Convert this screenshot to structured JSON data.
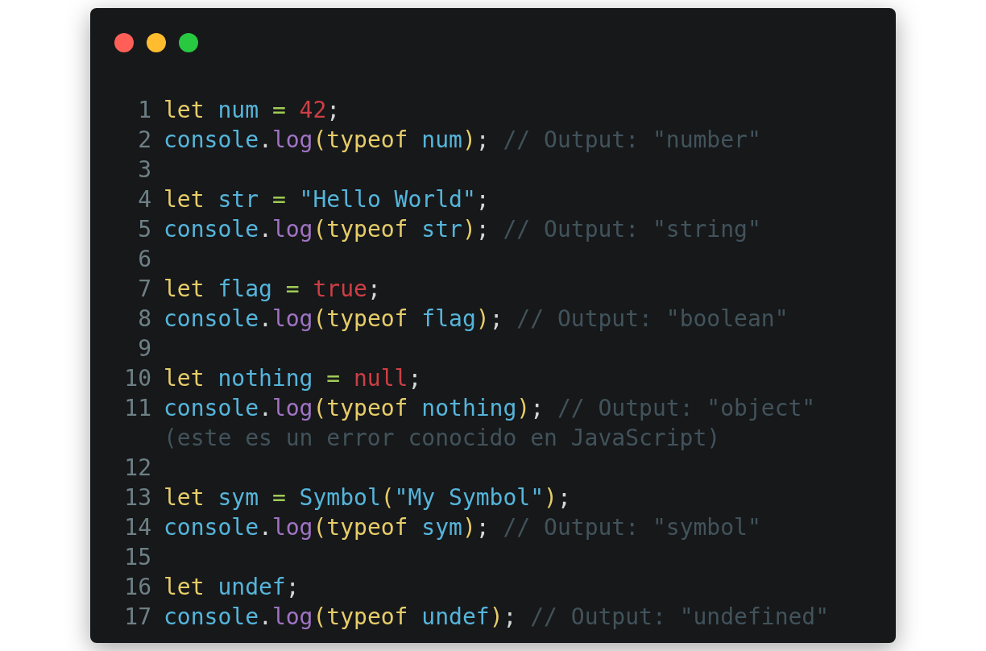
{
  "window": {
    "controls": [
      {
        "color": "#ff5f57"
      },
      {
        "color": "#febc2e"
      },
      {
        "color": "#28c840"
      }
    ]
  },
  "code": {
    "lines": [
      {
        "number": "1",
        "tokens": [
          {
            "text": "let ",
            "kind": "keyword"
          },
          {
            "text": "num ",
            "kind": "ident"
          },
          {
            "text": "= ",
            "kind": "operator"
          },
          {
            "text": "42",
            "kind": "literal"
          },
          {
            "text": ";",
            "kind": "plain"
          }
        ]
      },
      {
        "number": "2",
        "tokens": [
          {
            "text": "console",
            "kind": "ident"
          },
          {
            "text": ".",
            "kind": "plain"
          },
          {
            "text": "log",
            "kind": "method"
          },
          {
            "text": "(",
            "kind": "keyword"
          },
          {
            "text": "typeof ",
            "kind": "keyword"
          },
          {
            "text": "num",
            "kind": "ident"
          },
          {
            "text": ")",
            "kind": "keyword"
          },
          {
            "text": "; ",
            "kind": "plain"
          },
          {
            "text": "// Output: \"number\"",
            "kind": "comment"
          }
        ]
      },
      {
        "number": "3"
      },
      {
        "number": "4",
        "tokens": [
          {
            "text": "let ",
            "kind": "keyword"
          },
          {
            "text": "str ",
            "kind": "ident"
          },
          {
            "text": "= ",
            "kind": "operator"
          },
          {
            "text": "\"Hello World\"",
            "kind": "string"
          },
          {
            "text": ";",
            "kind": "plain"
          }
        ]
      },
      {
        "number": "5",
        "tokens": [
          {
            "text": "console",
            "kind": "ident"
          },
          {
            "text": ".",
            "kind": "plain"
          },
          {
            "text": "log",
            "kind": "method"
          },
          {
            "text": "(",
            "kind": "keyword"
          },
          {
            "text": "typeof ",
            "kind": "keyword"
          },
          {
            "text": "str",
            "kind": "ident"
          },
          {
            "text": ")",
            "kind": "keyword"
          },
          {
            "text": "; ",
            "kind": "plain"
          },
          {
            "text": "// Output: \"string\"",
            "kind": "comment"
          }
        ]
      },
      {
        "number": "6"
      },
      {
        "number": "7",
        "tokens": [
          {
            "text": "let ",
            "kind": "keyword"
          },
          {
            "text": "flag ",
            "kind": "ident"
          },
          {
            "text": "= ",
            "kind": "operator"
          },
          {
            "text": "true",
            "kind": "literal"
          },
          {
            "text": ";",
            "kind": "plain"
          }
        ]
      },
      {
        "number": "8",
        "tokens": [
          {
            "text": "console",
            "kind": "ident"
          },
          {
            "text": ".",
            "kind": "plain"
          },
          {
            "text": "log",
            "kind": "method"
          },
          {
            "text": "(",
            "kind": "keyword"
          },
          {
            "text": "typeof ",
            "kind": "keyword"
          },
          {
            "text": "flag",
            "kind": "ident"
          },
          {
            "text": ")",
            "kind": "keyword"
          },
          {
            "text": "; ",
            "kind": "plain"
          },
          {
            "text": "// Output: \"boolean\"",
            "kind": "comment"
          }
        ]
      },
      {
        "number": "9"
      },
      {
        "number": "10",
        "tokens": [
          {
            "text": "let ",
            "kind": "keyword"
          },
          {
            "text": "nothing ",
            "kind": "ident"
          },
          {
            "text": "= ",
            "kind": "operator"
          },
          {
            "text": "null",
            "kind": "literal"
          },
          {
            "text": ";",
            "kind": "plain"
          }
        ]
      },
      {
        "number": "11",
        "tokens": [
          {
            "text": "console",
            "kind": "ident"
          },
          {
            "text": ".",
            "kind": "plain"
          },
          {
            "text": "log",
            "kind": "method"
          },
          {
            "text": "(",
            "kind": "keyword"
          },
          {
            "text": "typeof ",
            "kind": "keyword"
          },
          {
            "text": "nothing",
            "kind": "ident"
          },
          {
            "text": ")",
            "kind": "keyword"
          },
          {
            "text": "; ",
            "kind": "plain"
          },
          {
            "text": "// Output: \"object\" (este es un error conocido en JavaScript)",
            "kind": "comment"
          }
        ]
      },
      {
        "number": "12"
      },
      {
        "number": "13",
        "tokens": [
          {
            "text": "let ",
            "kind": "keyword"
          },
          {
            "text": "sym ",
            "kind": "ident"
          },
          {
            "text": "= ",
            "kind": "operator"
          },
          {
            "text": "Symbol",
            "kind": "ident"
          },
          {
            "text": "(",
            "kind": "keyword"
          },
          {
            "text": "\"My Symbol\"",
            "kind": "string"
          },
          {
            "text": ")",
            "kind": "keyword"
          },
          {
            "text": ";",
            "kind": "plain"
          }
        ]
      },
      {
        "number": "14",
        "tokens": [
          {
            "text": "console",
            "kind": "ident"
          },
          {
            "text": ".",
            "kind": "plain"
          },
          {
            "text": "log",
            "kind": "method"
          },
          {
            "text": "(",
            "kind": "keyword"
          },
          {
            "text": "typeof ",
            "kind": "keyword"
          },
          {
            "text": "sym",
            "kind": "ident"
          },
          {
            "text": ")",
            "kind": "keyword"
          },
          {
            "text": "; ",
            "kind": "plain"
          },
          {
            "text": "// Output: \"symbol\"",
            "kind": "comment"
          }
        ]
      },
      {
        "number": "15"
      },
      {
        "number": "16",
        "tokens": [
          {
            "text": "let ",
            "kind": "keyword"
          },
          {
            "text": "undef",
            "kind": "ident"
          },
          {
            "text": ";",
            "kind": "plain"
          }
        ]
      },
      {
        "number": "17",
        "tokens": [
          {
            "text": "console",
            "kind": "ident"
          },
          {
            "text": ".",
            "kind": "plain"
          },
          {
            "text": "log",
            "kind": "method"
          },
          {
            "text": "(",
            "kind": "keyword"
          },
          {
            "text": "typeof ",
            "kind": "keyword"
          },
          {
            "text": "undef",
            "kind": "ident"
          },
          {
            "text": ")",
            "kind": "keyword"
          },
          {
            "text": "; ",
            "kind": "plain"
          },
          {
            "text": "// Output: \"undefined\"",
            "kind": "comment"
          }
        ]
      }
    ]
  }
}
